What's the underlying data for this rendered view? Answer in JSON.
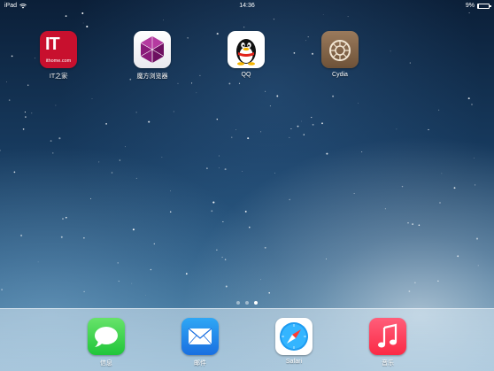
{
  "status_bar": {
    "device": "iPad",
    "time": "14:36",
    "battery_text": "9%",
    "battery_level": 0.09,
    "wifi_icon": "wifi-icon"
  },
  "home_apps": [
    {
      "name": "IT之家",
      "icon": "ithome-icon",
      "icon_text_big": "IT",
      "icon_text_small": "ithome.com"
    },
    {
      "name": "魔方浏览器",
      "icon": "magic-cube-browser-icon"
    },
    {
      "name": "QQ",
      "icon": "qq-penguin-icon"
    },
    {
      "name": "Cydia",
      "icon": "cydia-icon"
    }
  ],
  "page_indicator": {
    "total": 3,
    "active_index": 2
  },
  "dock_apps": [
    {
      "name": "信息",
      "icon": "messages-icon"
    },
    {
      "name": "邮件",
      "icon": "mail-icon"
    },
    {
      "name": "Safari",
      "icon": "safari-icon"
    },
    {
      "name": "音乐",
      "icon": "music-icon"
    }
  ],
  "colors": {
    "ithome_red": "#c8102e",
    "messages_green": "#20c53a",
    "mail_blue": "#1a6fe0",
    "music_pink": "#fb2a45"
  }
}
